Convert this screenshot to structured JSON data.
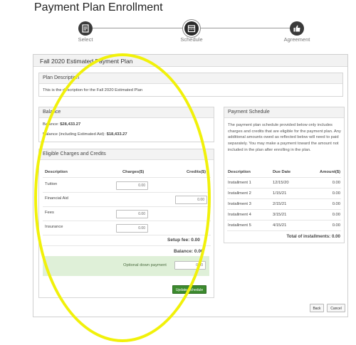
{
  "page": {
    "title": "Payment Plan Enrollment"
  },
  "stepper": {
    "steps": [
      {
        "label": "Select",
        "icon": "document-icon"
      },
      {
        "label": "Schedule",
        "icon": "calendar-icon",
        "active": true
      },
      {
        "label": "Agreement",
        "icon": "thumbs-up-icon"
      }
    ]
  },
  "plan": {
    "title": "Fall 2020 Estimated Payment Plan"
  },
  "description": {
    "heading": "Plan Description",
    "text": "This is the description for the Fall 2020 Estimated Plan"
  },
  "balance": {
    "heading": "Balance",
    "balance_label": "Balance:",
    "balance_value": "$28,433.27",
    "estimated_label": "Balance (including Estimated Aid):",
    "estimated_value": "$18,433.27"
  },
  "charges": {
    "heading": "Eligible Charges and Credits",
    "columns": {
      "description": "Description",
      "charges": "Charges($)",
      "credits": "Credits($)"
    },
    "rows": [
      {
        "name": "Tuition",
        "charges": "0.00",
        "credits": null
      },
      {
        "name": "Financial Aid",
        "charges": null,
        "credits": "0.00"
      },
      {
        "name": "Fees",
        "charges": "0.00",
        "credits": null
      },
      {
        "name": "Insurance",
        "charges": "0.00",
        "credits": null
      }
    ],
    "setup_fee_label": "Setup fee:",
    "setup_fee_value": "0.00",
    "balance_label": "Balance:",
    "balance_value": "0.00",
    "down_payment_label": "Optional down payment",
    "down_payment_value": "0.00",
    "update_button": "Update Schedule"
  },
  "schedule": {
    "heading": "Payment Schedule",
    "text": "The payment plan schedule provided below only includes charges and credits that are eligible for the payment plan. Any additional amounts owed as reflected below will need to paid separately. You may make a payment toward the amount not included in the plan after enrolling in the plan.",
    "columns": {
      "description": "Description",
      "due": "Due Date",
      "amount": "Amount($)"
    },
    "rows": [
      {
        "name": "Installment 1",
        "due": "12/15/20",
        "amount": "0.00"
      },
      {
        "name": "Installment 2",
        "due": "1/15/21",
        "amount": "0.00"
      },
      {
        "name": "Installment 3",
        "due": "2/15/21",
        "amount": "0.00"
      },
      {
        "name": "Installment 4",
        "due": "3/15/21",
        "amount": "0.00"
      },
      {
        "name": "Installment 5",
        "due": "4/15/21",
        "amount": "0.00"
      }
    ],
    "total_label": "Total of installments:",
    "total_value": "0.00"
  },
  "footer": {
    "back": "Back",
    "cancel": "Cancel"
  },
  "colors": {
    "highlight": "#f1f10a",
    "update_button": "#3c8a2e",
    "down_payment_bg": "#dff0d8"
  }
}
